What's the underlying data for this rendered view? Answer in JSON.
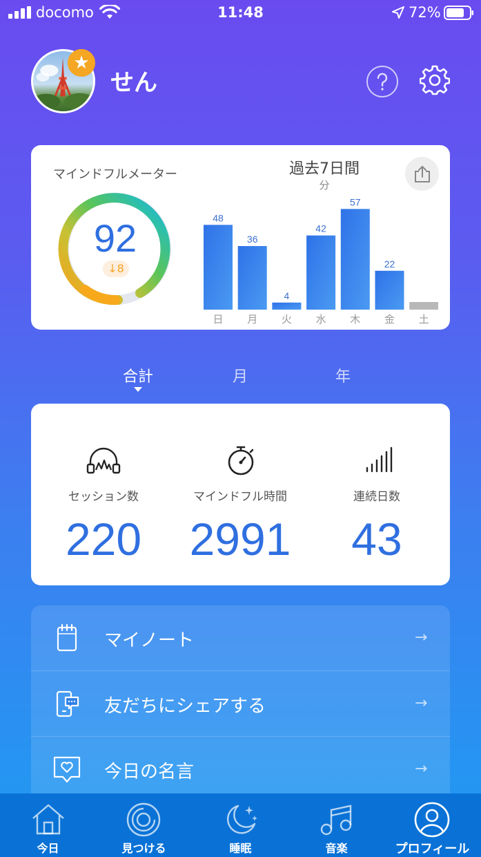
{
  "status_bar": {
    "carrier": "docomo",
    "time": "11:48",
    "battery": "72%"
  },
  "header": {
    "user_name": "せん"
  },
  "meter": {
    "title": "マインドフルメーター",
    "score": "92",
    "delta": "8",
    "period_title": "過去7日間",
    "unit": "分"
  },
  "chart_data": {
    "type": "bar",
    "categories": [
      "日",
      "月",
      "火",
      "水",
      "木",
      "金",
      "土"
    ],
    "values": [
      48,
      36,
      4,
      42,
      57,
      22,
      0
    ],
    "value_labels": [
      "48",
      "36",
      "4",
      "42",
      "57",
      "22",
      ""
    ],
    "title": "過去7日間",
    "ylabel": "分",
    "ylim": [
      0,
      60
    ],
    "colors": {
      "bar": "#3b86ee",
      "empty": "#b8b8b8",
      "label": "#3b6fd0"
    }
  },
  "tabs": [
    {
      "label": "合計"
    },
    {
      "label": "月"
    },
    {
      "label": "年"
    }
  ],
  "stats": [
    {
      "label": "セッション数",
      "value": "220",
      "icon": "headphones-icon"
    },
    {
      "label": "マインドフル時間",
      "value": "2991",
      "icon": "stopwatch-icon"
    },
    {
      "label": "連続日数",
      "value": "43",
      "icon": "signal-bars-icon"
    }
  ],
  "menu": [
    {
      "label": "マイノート",
      "icon": "notepad-icon"
    },
    {
      "label": "友だちにシェアする",
      "icon": "phone-chat-icon"
    },
    {
      "label": "今日の名言",
      "icon": "heart-speech-icon"
    }
  ],
  "tab_bar": [
    {
      "label": "今日",
      "icon": "home-icon"
    },
    {
      "label": "見つける",
      "icon": "target-icon"
    },
    {
      "label": "睡眠",
      "icon": "moon-icon"
    },
    {
      "label": "音楽",
      "icon": "music-note-icon"
    },
    {
      "label": "プロフィール",
      "icon": "profile-icon"
    }
  ],
  "colors": {
    "accent": "#2f6fe0",
    "streak_badge": "#f5a623",
    "tab_bar": "#0a72d6"
  }
}
